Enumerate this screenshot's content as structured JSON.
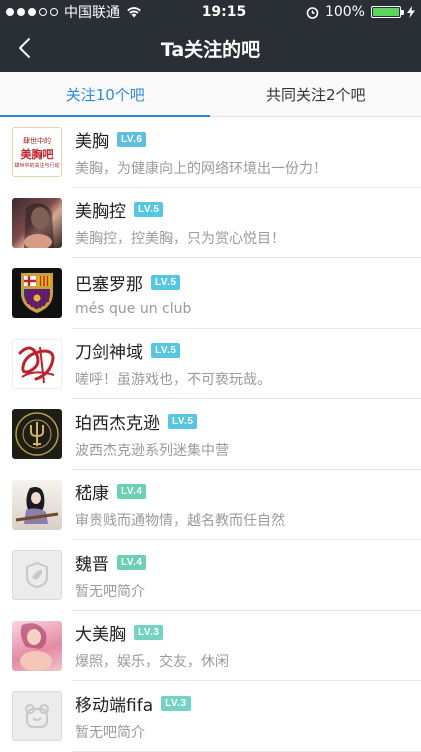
{
  "status": {
    "carrier": "中国联通",
    "time": "19:15",
    "battery": "100%",
    "battery_level": 1.0
  },
  "nav": {
    "title": "Ta关注的吧"
  },
  "tabs": [
    {
      "label": "关注10个吧"
    },
    {
      "label": "共同关注2个吧"
    }
  ],
  "bars": [
    {
      "name": "美胸",
      "level": "LV.6",
      "desc": "美胸，为健康向上的网络环境出一份力！",
      "avatar_text": {
        "top": "肆世中的",
        "main": "美胸吧",
        "bottom": "肆世中的关注与行动"
      }
    },
    {
      "name": "美胸控",
      "level": "LV.5",
      "desc": "美胸控，控美胸，只为赏心悦目！"
    },
    {
      "name": "巴塞罗那",
      "level": "LV.5",
      "desc": "més que un club"
    },
    {
      "name": "刀剑神域",
      "level": "LV.5",
      "desc": "嗟呼！虽游戏也，不可亵玩哉。"
    },
    {
      "name": "珀西杰克逊",
      "level": "LV.5",
      "desc": "波西杰克逊系列迷集中营"
    },
    {
      "name": "嵇康",
      "level": "LV.4",
      "desc": "审贵贱而通物情，越名教而任自然"
    },
    {
      "name": "魏晋",
      "level": "LV.4",
      "desc": "暂无吧简介"
    },
    {
      "name": "大美胸",
      "level": "LV.3",
      "desc": "爆照，娱乐，交友，休闲"
    },
    {
      "name": "移动端fifa",
      "level": "LV.3",
      "desc": "暂无吧简介"
    }
  ]
}
